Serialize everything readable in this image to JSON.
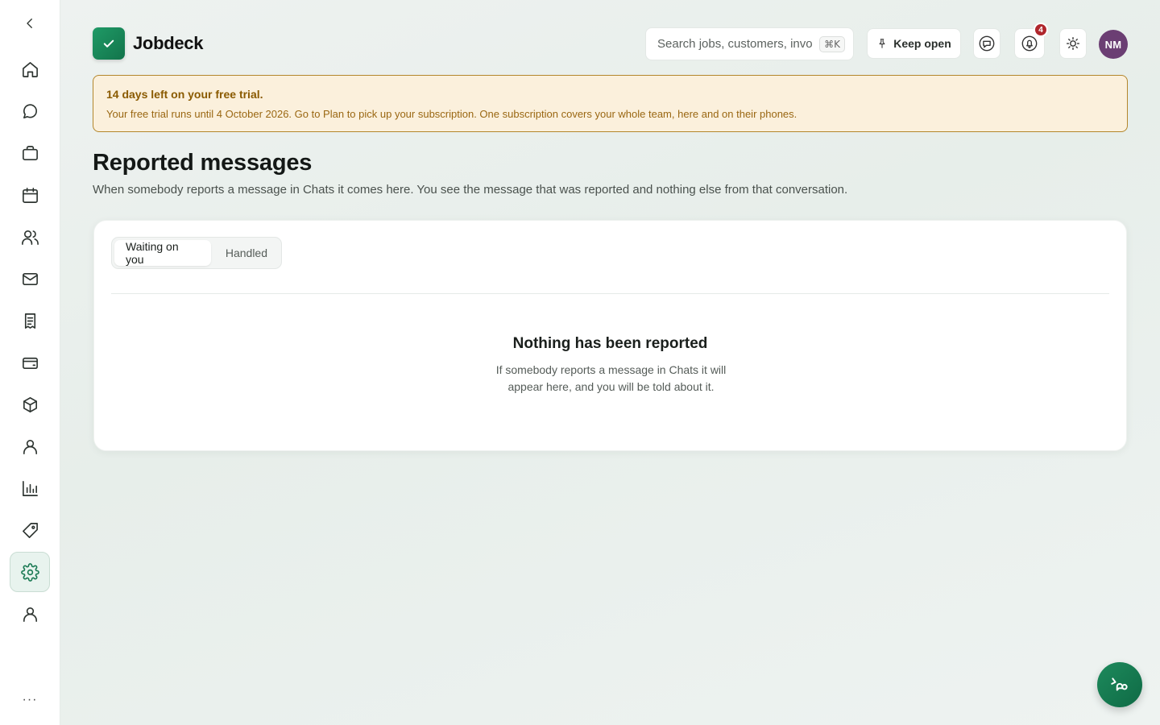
{
  "app": {
    "name": "Jobdeck"
  },
  "sidebar": {
    "items": [
      {
        "icon": "home-icon"
      },
      {
        "icon": "chat-icon"
      },
      {
        "icon": "briefcase-icon"
      },
      {
        "icon": "calendar-icon"
      },
      {
        "icon": "users-icon"
      },
      {
        "icon": "mail-icon"
      },
      {
        "icon": "receipt-icon"
      },
      {
        "icon": "wallet-icon"
      },
      {
        "icon": "box-icon"
      },
      {
        "icon": "person-icon"
      },
      {
        "icon": "bar-chart-icon"
      },
      {
        "icon": "tag-icon"
      },
      {
        "icon": "gear-icon",
        "active": true
      },
      {
        "icon": "profile-icon"
      }
    ],
    "more_label": "···"
  },
  "header": {
    "search": {
      "placeholder": "Search jobs, customers, invoices",
      "shortcut": "⌘K"
    },
    "keep_open_label": "Keep open",
    "notifications_count": "4",
    "avatar_initials": "NM"
  },
  "trial_banner": {
    "title": "14 days left on your free trial.",
    "body": "Your free trial runs until 4 October 2026. Go to Plan to pick up your subscription. One subscription covers your whole team, here and on their phones."
  },
  "page": {
    "title": "Reported messages",
    "subtitle": "When somebody reports a message in Chats it comes here. You see the message that was reported and nothing else from that conversation."
  },
  "tabs": [
    {
      "label": "Waiting on you",
      "active": true
    },
    {
      "label": "Handled",
      "active": false
    }
  ],
  "empty_state": {
    "title": "Nothing has been reported",
    "body": "If somebody reports a message in Chats it will appear here, and you will be told about it."
  },
  "colors": {
    "accent": "#1b7a54",
    "brand_green": "#1f9a66",
    "trial_bg": "#fbf0dc",
    "trial_border": "#b3862c",
    "badge": "#b0272d",
    "avatar": "#6b3e73"
  }
}
